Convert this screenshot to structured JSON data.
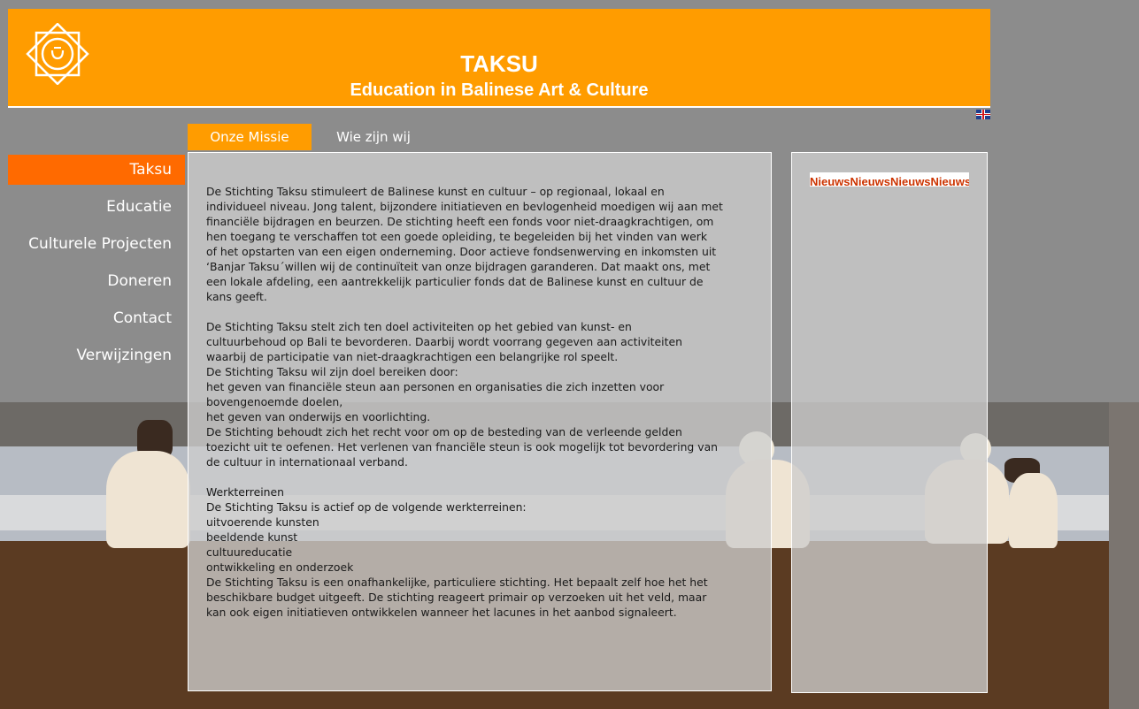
{
  "colors": {
    "header_bg": "#ff9c00",
    "active_nav_bg": "#ff6a00",
    "active_tab_bg": "#ff9c00",
    "news_text": "#cc3300"
  },
  "header": {
    "logo_icon": "sun-star-logo-icon",
    "title": "TAKSU",
    "subtitle": "Education in Balinese Art & Culture",
    "language_flag_icon": "uk-flag-icon"
  },
  "tabs": [
    {
      "label": "Onze Missie",
      "active": true
    },
    {
      "label": "Wie zijn wij",
      "active": false
    }
  ],
  "nav": {
    "items": [
      {
        "label": "Taksu",
        "active": true
      },
      {
        "label": "Educatie"
      },
      {
        "label": "Culturele Projecten"
      },
      {
        "label": "Doneren"
      },
      {
        "label": "Contact"
      },
      {
        "label": "Verwijzingen"
      }
    ]
  },
  "content": {
    "p1": [
      "De Stichting Taksu stimuleert de Balinese kunst en cultuur – op regionaal, lokaal en",
      "individueel niveau. Jong talent, bijzondere initiatieven en bevlogenheid moedigen wij aan met",
      "financiële bijdragen en beurzen. De stichting heeft een fonds voor niet-draagkrachtigen, om",
      "hen toegang te verschaffen tot een goede opleiding, te begeleiden bij het vinden van werk",
      "of het opstarten van een eigen onderneming. Door actieve fondsenwerving en inkomsten uit",
      "‘Banjar Taksu´willen wij de continuïteit van onze bijdragen garanderen. Dat maakt ons, met",
      "een lokale afdeling, een aantrekkelijk particulier fonds dat de Balinese kunst en cultuur de",
      "kans geeft."
    ],
    "p2": [
      "De Stichting Taksu stelt zich ten doel activiteiten op het gebied van kunst- en",
      "cultuurbehoud op Bali te bevorderen. Daarbij wordt voorrang gegeven aan activiteiten",
      "waarbij de participatie van niet-draagkrachtigen een belangrijke rol speelt.",
      "De Stichting Taksu wil zijn doel bereiken door:",
      "het geven van financiële steun aan personen en organisaties die zich inzetten voor",
      "bovengenoemde doelen,",
      "het geven van onderwijs en voorlichting.",
      "De Stichting behoudt zich het recht voor om op de besteding van de verleende gelden",
      "toezicht uit te oefenen. Het verlenen van fnanciële steun is ook mogelijk tot bevordering van",
      "de cultuur in internationaal verband."
    ],
    "p3": [
      "Werkterreinen",
      "De Stichting Taksu is actief op de volgende werkterreinen:",
      "uitvoerende kunsten",
      "beeldende kunst",
      "cultuureducatie",
      "ontwikkeling en onderzoek",
      "De Stichting Taksu is een onafhankelijke, particuliere stichting. Het bepaalt zelf hoe het het",
      "beschikbare budget uitgeeft. De stichting reageert primair op verzoeken uit het veld, maar",
      "kan ook eigen initiatieven ontwikkelen wanneer het lacunes in het aanbod signaleert."
    ]
  },
  "news": {
    "ticker_text": "NieuwsNieuwsNieuwsNieuwsNieuws"
  }
}
